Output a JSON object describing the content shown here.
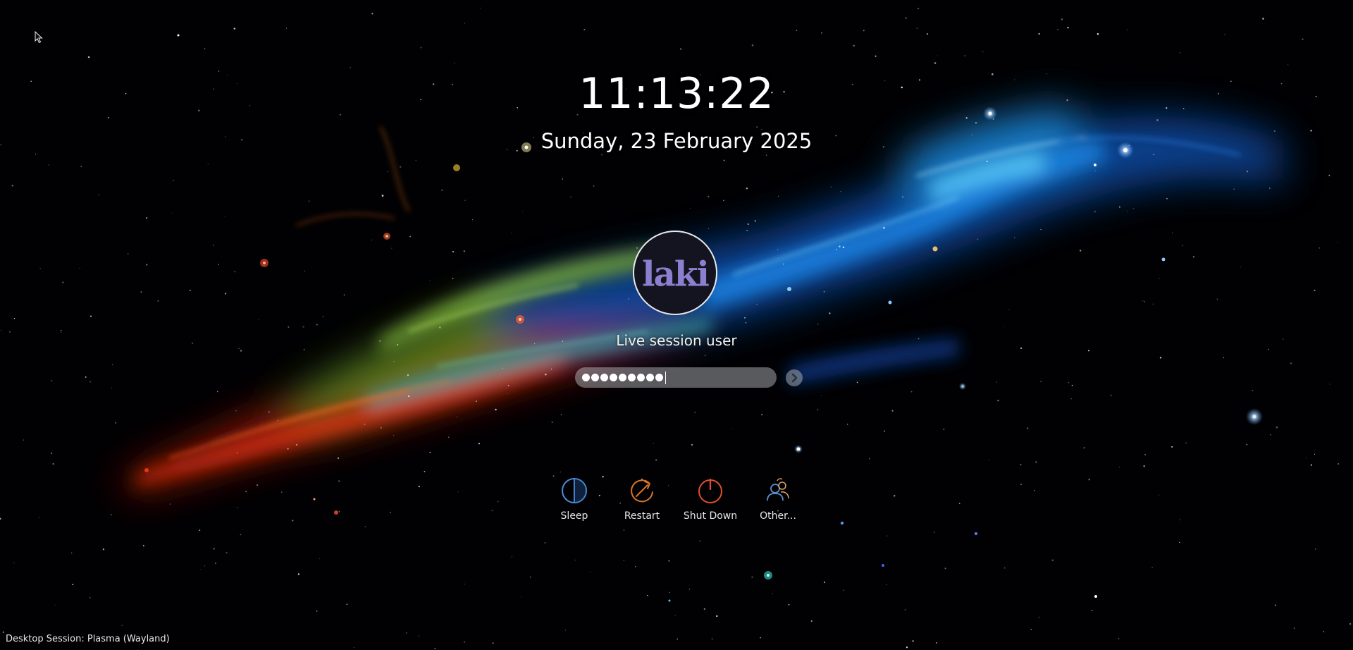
{
  "lockscreen": {
    "time": "11:13:22",
    "date": "Sunday, 23 February 2025",
    "user": {
      "name": "Live session user",
      "avatar_text": "laki",
      "avatar_icon": "laki-logo-avatar"
    },
    "password": {
      "masked_count": 9,
      "accent_color": "#ffffff"
    },
    "login_icon": "arrow-right-icon",
    "actions": [
      {
        "label": "Sleep",
        "icon": "sleep-icon",
        "color": "#4a90d9"
      },
      {
        "label": "Restart",
        "icon": "restart-icon",
        "color": "#d9742a"
      },
      {
        "label": "Shut Down",
        "icon": "power-icon",
        "color": "#e0502a"
      },
      {
        "label": "Other...",
        "icon": "switch-user-icon",
        "color": "#5a8fd0"
      }
    ],
    "session": "Desktop Session: Plasma (Wayland)"
  },
  "colors": {
    "background": "#010103",
    "nebula_red": "#c8200c",
    "nebula_green": "#6fae38",
    "nebula_blue": "#1f78e0",
    "avatar_text": "#8d7fcf"
  }
}
